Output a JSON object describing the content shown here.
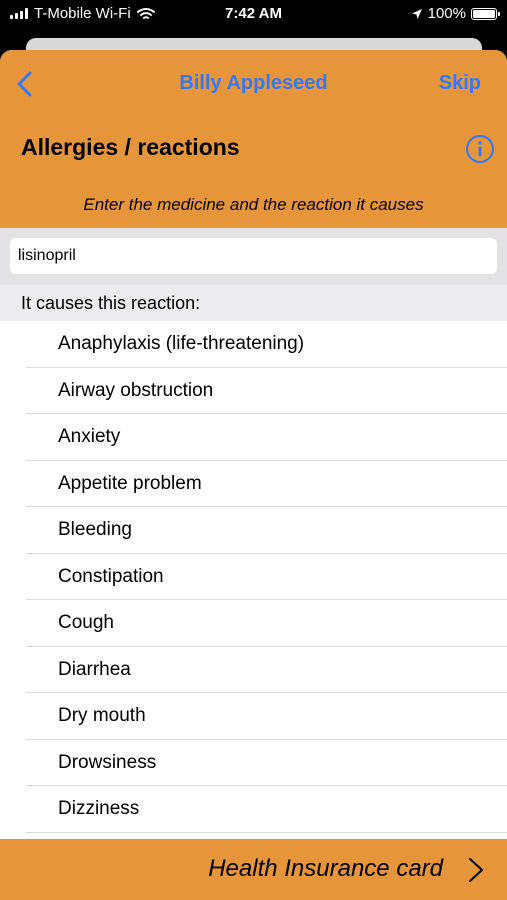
{
  "status_bar": {
    "carrier": "T-Mobile Wi-Fi",
    "time": "7:42 AM",
    "battery": "100%"
  },
  "nav": {
    "title": "Billy Appleseed",
    "skip_label": "Skip",
    "back_icon": "chevron-left-icon"
  },
  "page": {
    "title": "Allergies / reactions",
    "info_icon": "info-icon",
    "instruction": "Enter the medicine and the reaction it causes"
  },
  "medicine_input": {
    "value": "lisinopril"
  },
  "reactions": {
    "section_label": "It causes this reaction:",
    "items": [
      "Anaphylaxis (life-threatening)",
      "Airway obstruction",
      "Anxiety",
      "Appetite problem",
      "Bleeding",
      "Constipation",
      "Cough",
      "Diarrhea",
      "Dry mouth",
      "Drowsiness",
      "Dizziness"
    ]
  },
  "footer": {
    "next_label": "Health Insurance card",
    "chevron_icon": "chevron-right-icon"
  },
  "colors": {
    "accent_orange": "#E6953B",
    "link_blue": "#3478F6"
  }
}
